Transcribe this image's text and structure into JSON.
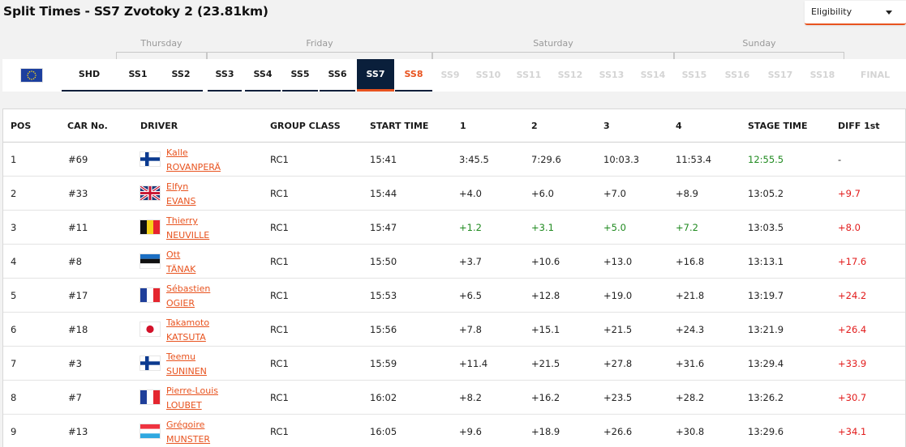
{
  "title": "Split Times - SS7 Zvotoky 2 (23.81km)",
  "eligibility": {
    "label": "Eligibility"
  },
  "days": [
    "Thursday",
    "Friday",
    "Saturday",
    "Sunday"
  ],
  "tabs": [
    "SHD",
    "SS1",
    "SS2",
    "SS3",
    "SS4",
    "SS5",
    "SS6",
    "SS7",
    "SS8",
    "SS9",
    "SS10",
    "SS11",
    "SS12",
    "SS13",
    "SS14",
    "SS15",
    "SS16",
    "SS17",
    "SS18",
    "FINAL"
  ],
  "tab_states": {
    "active": "SS7",
    "highlighted": "SS8",
    "disabled": [
      "SS9",
      "SS10",
      "SS11",
      "SS12",
      "SS13",
      "SS14",
      "SS15",
      "SS16",
      "SS17",
      "SS18",
      "FINAL"
    ]
  },
  "columns": [
    "POS",
    "CAR No.",
    "DRIVER",
    "GROUP CLASS",
    "START TIME",
    "1",
    "2",
    "3",
    "4",
    "STAGE TIME",
    "DIFF 1st"
  ],
  "rows": [
    {
      "pos": "1",
      "car": "#69",
      "first": "Kalle",
      "last": "ROVANPERÄ",
      "flag": "finland",
      "group": "RC1",
      "start": "15:41",
      "s1": "3:45.5",
      "s2": "7:29.6",
      "s3": "10:03.3",
      "s4": "11:53.4",
      "stage": "12:55.5",
      "diff": "-"
    },
    {
      "pos": "2",
      "car": "#33",
      "first": "Elfyn",
      "last": "EVANS",
      "flag": "united-kingdom",
      "group": "RC1",
      "start": "15:44",
      "s1": "+4.0",
      "s2": "+6.0",
      "s3": "+7.0",
      "s4": "+8.9",
      "stage": "13:05.2",
      "diff": "+9.7"
    },
    {
      "pos": "3",
      "car": "#11",
      "first": "Thierry",
      "last": "NEUVILLE",
      "flag": "belgium",
      "group": "RC1",
      "start": "15:47",
      "s1": "+1.2",
      "s2": "+3.1",
      "s3": "+5.0",
      "s4": "+7.2",
      "stage": "13:03.5",
      "diff": "+8.0"
    },
    {
      "pos": "4",
      "car": "#8",
      "first": "Ott",
      "last": "TÄNAK",
      "flag": "estonia",
      "group": "RC1",
      "start": "15:50",
      "s1": "+3.7",
      "s2": "+10.6",
      "s3": "+13.0",
      "s4": "+16.8",
      "stage": "13:13.1",
      "diff": "+17.6"
    },
    {
      "pos": "5",
      "car": "#17",
      "first": "Sébastien",
      "last": "OGIER",
      "flag": "france",
      "group": "RC1",
      "start": "15:53",
      "s1": "+6.5",
      "s2": "+12.8",
      "s3": "+19.0",
      "s4": "+21.8",
      "stage": "13:19.7",
      "diff": "+24.2"
    },
    {
      "pos": "6",
      "car": "#18",
      "first": "Takamoto",
      "last": "KATSUTA",
      "flag": "japan",
      "group": "RC1",
      "start": "15:56",
      "s1": "+7.8",
      "s2": "+15.1",
      "s3": "+21.5",
      "s4": "+24.3",
      "stage": "13:21.9",
      "diff": "+26.4"
    },
    {
      "pos": "7",
      "car": "#3",
      "first": "Teemu",
      "last": "SUNINEN",
      "flag": "finland",
      "group": "RC1",
      "start": "15:59",
      "s1": "+11.4",
      "s2": "+21.5",
      "s3": "+27.8",
      "s4": "+31.6",
      "stage": "13:29.4",
      "diff": "+33.9"
    },
    {
      "pos": "8",
      "car": "#7",
      "first": "Pierre-Louis",
      "last": "LOUBET",
      "flag": "france",
      "group": "RC1",
      "start": "16:02",
      "s1": "+8.2",
      "s2": "+16.2",
      "s3": "+23.5",
      "s4": "+28.2",
      "stage": "13:26.2",
      "diff": "+30.7"
    },
    {
      "pos": "9",
      "car": "#13",
      "first": "Grégoire",
      "last": "MUNSTER",
      "flag": "luxembourg",
      "group": "RC1",
      "start": "16:05",
      "s1": "+9.6",
      "s2": "+18.9",
      "s3": "+26.6",
      "s4": "+30.8",
      "stage": "13:29.6",
      "diff": "+34.1"
    }
  ],
  "colors": {
    "accent_orange": "#e8531f",
    "navy": "#0a1f3b",
    "fastest_green": "#1f8a1f",
    "diff_red": "#e21b1b"
  }
}
